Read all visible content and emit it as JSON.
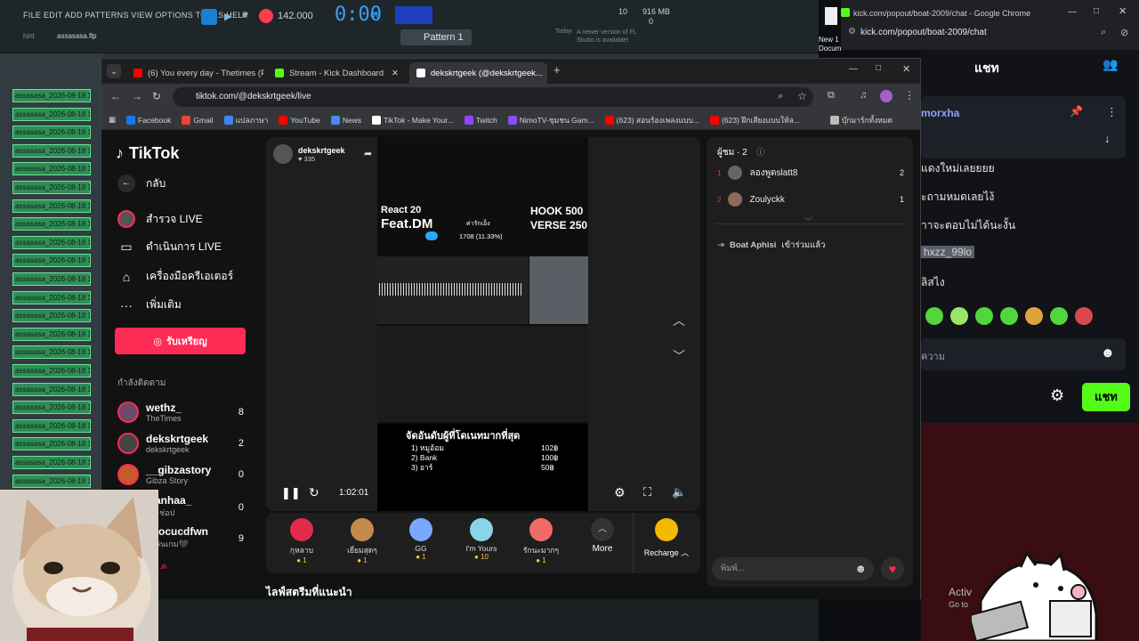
{
  "fl": {
    "menu": "FILE EDIT ADD PATTERNS VIEW OPTIONS TOOLS HELP",
    "tempo": "142.000",
    "time": "0:00",
    "time_small": "00",
    "pattern": "Pattern 1",
    "file": "assasasa.flp",
    "hint": "hint",
    "notice_label": "Today",
    "notice": "A newer version of FL Studio is available!",
    "cpu": "10",
    "mem": "916 MB",
    "mem2": "0",
    "patterns": [
      "assasasa_2026-08-18 15..",
      "assasasa_2026-08-18 15..",
      "assasasa_2026-08-18 15..",
      "assasasa_2026-08-18 15..",
      "assasasa_2026-08-18 15..",
      "assasasa_2026-08-18 15..",
      "assasasa_2026-08-18 15..",
      "assasasa_2026-08-18 15..",
      "assasasa_2026-08-18 15..",
      "assasasa_2026-08-18 15..",
      "assasasa_2026-08-18 15..",
      "assasasa_2026-08-18 15..",
      "assasasa_2026-08-18 15..",
      "assasasa_2026-08-18 15..",
      "assasasa_2026-08-18 15..",
      "assasasa_2026-08-18 15..",
      "assasasa_2026-08-18 15..",
      "assasasa_2026-08-18 15..",
      "assasasa_2026-08-18 15..",
      "assasasa_2026-08-18 15..",
      "assasasa_2026-08-18 15..",
      "assasasa_2026-08-18 15..",
      "assasasa_2026-08-18 15.."
    ]
  },
  "chrome": {
    "tabs": [
      {
        "title": "(6) You every day - Thetimes (P...",
        "fav": "#ff0000"
      },
      {
        "title": "Stream - Kick Dashboard",
        "fav": "#53fc18"
      },
      {
        "title": "dekskrtgeek (@dekskrtgeek...",
        "fav": "#ffffff"
      }
    ],
    "url": "tiktok.com/@dekskrtgeek/live",
    "bookmarks": [
      "Facebook",
      "Gmail",
      "แปลภาษา",
      "YouTube",
      "News",
      "TikTok - Make Your...",
      "Twitch",
      "NimoTV-ชุมชน Gam...",
      "(623) สอนร้องเพลงแบบ...",
      "(623) ฝึกเสียงแบบให้ล...",
      "บุ๊กมาร์กทั้งหมด"
    ]
  },
  "tiktok": {
    "logo": "TikTok",
    "back": "กลับ",
    "nav": [
      "สำรวจ LIVE",
      "ดำเนินการ LIVE",
      "เครื่องมือครีเอเตอร์",
      "เพิ่มเติม"
    ],
    "get_coins": "รับเหรียญ",
    "following_label": "กำลังติดตาม",
    "following": [
      {
        "name": "wethz_",
        "sub": "TheTimes",
        "count": "8"
      },
      {
        "name": "dekskrtgeek",
        "sub": "dekskrtgeek",
        "count": "2"
      },
      {
        "name": "__gibzastory",
        "sub": "Gibza Story",
        "count": "0"
      },
      {
        "name": "...anhaa_",
        "sub": "...า ช่อป",
        "count": "0"
      },
      {
        "name": "...focucdfwn",
        "sub": "...เล่นเกม🖤",
        "count": "9"
      }
    ],
    "more_link": "...ด",
    "host_name": "dekskrtgeek",
    "host_likes": "335",
    "overlay": {
      "react": "React 20",
      "feat": "Feat.DM",
      "price_label": "ค่ารักเอ็ง",
      "progress": "1708 (11.33%)",
      "progress_fraction": 0.1133,
      "hook": "HOOK 500",
      "verse": "VERSE 250",
      "rank_title": "จัดอันดับผู้ที่โดเนทมากที่สุด",
      "ranks": [
        "1) หมูอ้อม",
        "2) Bank",
        "3) อาร์"
      ],
      "rank_vals": [
        "102฿",
        "100฿",
        "50฿"
      ]
    },
    "time": "1:02:01",
    "gifts": [
      {
        "name": "กุหลาบ",
        "price": "1",
        "color": "#e02c4a"
      },
      {
        "name": "เยี่ยมสุดๆ",
        "price": "1",
        "color": "#c48a4e"
      },
      {
        "name": "GG",
        "price": "1",
        "color": "#7aa8ff"
      },
      {
        "name": "I'm Yours",
        "price": "10",
        "color": "#8ad4e8"
      },
      {
        "name": "รักนะมากๆ",
        "price": "1",
        "color": "#f06a6a"
      }
    ],
    "more": "More",
    "recharge": "Recharge",
    "recommended": "ไลฟ์สตรีมที่แนะนำ",
    "viewers_label": "ผู้ชม · 2",
    "viewers": [
      {
        "rank": "1",
        "name": "ลองพูดslatt8",
        "score": "2"
      },
      {
        "rank": "2",
        "name": "Zoulyckk",
        "score": "1"
      }
    ],
    "join_name": "Boat Aphisi",
    "join_text": "เข้าร่วมแล้ว",
    "comment_placeholder": "พิมพ์..."
  },
  "kick": {
    "window_title": "kick.com/popout/boat-2009/chat - Google Chrome",
    "url": "kick.com/popout/boat-2009/chat",
    "chat_title": "แชท",
    "pinned_user": "morxha",
    "lines": [
      "แดงใหม่เลยยยย",
      "ะถามหมดเลยไง้",
      "าาจะตอบไม่ได้นะงั้น",
      "hxzz_99lo",
      "ลิสไง"
    ],
    "input_placeholder": "ความ",
    "send": "แชท",
    "activate": "Activ",
    "goto": "Go to"
  },
  "desktop": {
    "new_doc": "New 1 Docum"
  }
}
